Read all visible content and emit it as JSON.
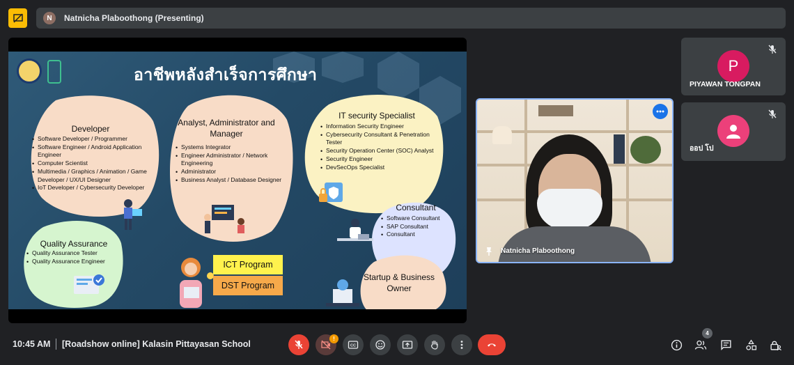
{
  "header": {
    "presenter_initial": "N",
    "presenter_label": "Natnicha Plaboothong (Presenting)"
  },
  "slide": {
    "title": "อาชีพหลังสำเร็จการศึกษา",
    "cards": {
      "developer": {
        "title": "Developer",
        "items": [
          "Software Developer / Programmer",
          "Software Engineer / Android Application Engineer",
          "Computer Scientist",
          "Multimedia / Graphics / Animation / Game Developer / UX/UI Designer",
          "IoT Developer / Cybersecurity Developer"
        ]
      },
      "analyst": {
        "title": "Analyst, Administrator and Manager",
        "items": [
          "Systems Integrator",
          "Engineer Administrator / Network Engineering",
          "Administrator",
          "Business Analyst / Database Designer"
        ]
      },
      "security": {
        "title": "IT security Specialist",
        "items": [
          "Information Security Engineer",
          "Cybersecurity Consultant & Penetration Tester",
          "Security Operation Center (SOC) Analyst",
          "Security Engineer",
          "DevSecOps Specialist"
        ]
      },
      "consultant": {
        "title": "Consultant",
        "items": [
          "Software Consultant",
          "SAP Consultant",
          "Consultant"
        ]
      },
      "qa": {
        "title": "Quality Assurance",
        "items": [
          "Quality Assurance Tester",
          "Quality Assurance Engineer"
        ]
      },
      "startup": {
        "title": "Startup & Business Owner"
      }
    },
    "programs": [
      "ICT Program",
      "DST Program"
    ]
  },
  "participants": [
    {
      "initial": "P",
      "name": "PIYAWAN TONGPAN",
      "color": "#d81b60"
    },
    {
      "initial": "",
      "name": "ออป โป",
      "color": "#ec407a"
    }
  ],
  "video": {
    "name": "Natnicha Plaboothong"
  },
  "footer": {
    "time": "10:45 AM",
    "meeting_title": "[Roadshow online] Kalasin Pittayasan School",
    "camera_alert": "!",
    "people_count": "4"
  },
  "colors": {
    "end_call": "#ea4335",
    "mic_off": "#ea4335",
    "present_icon_bg": "#fbbc04",
    "active_speaker_border": "#8ab4f8"
  }
}
